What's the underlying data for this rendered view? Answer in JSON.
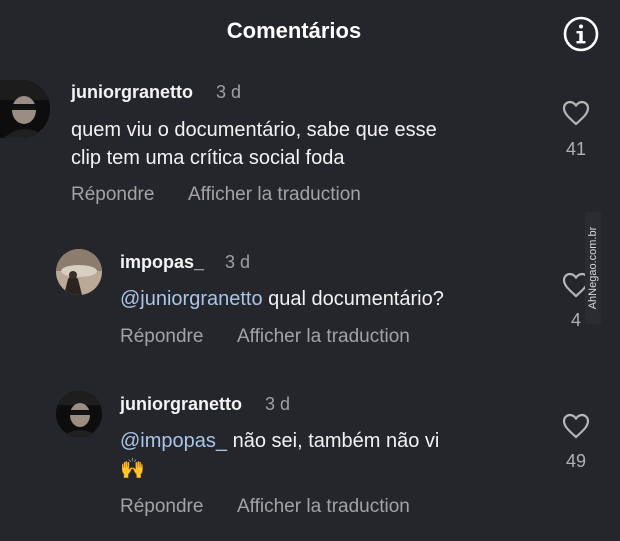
{
  "header": {
    "title": "Comentários"
  },
  "comments": [
    {
      "username": "juniorgranetto",
      "time": "3 d",
      "text": "quem viu o documentário, sabe que esse\nclip tem uma crítica social foda",
      "reply_label": "Répondre",
      "translate_label": "Afficher la traduction",
      "likes": "41"
    },
    {
      "username": "impopas_",
      "time": "3 d",
      "mention": "@juniorgranetto",
      "text": " qual documentário?",
      "reply_label": "Répondre",
      "translate_label": "Afficher la traduction",
      "likes": "4"
    },
    {
      "username": "juniorgranetto",
      "time": "3 d",
      "mention": "@impopas_",
      "text": " não sei, também não vi",
      "emoji": "🙌",
      "reply_label": "Répondre",
      "translate_label": "Afficher la traduction",
      "likes": "49"
    }
  ],
  "watermark": "AhNegao.com.br",
  "colors": {
    "background": "#24262b",
    "mention": "#aac5e8",
    "muted": "#a3a3a3"
  }
}
